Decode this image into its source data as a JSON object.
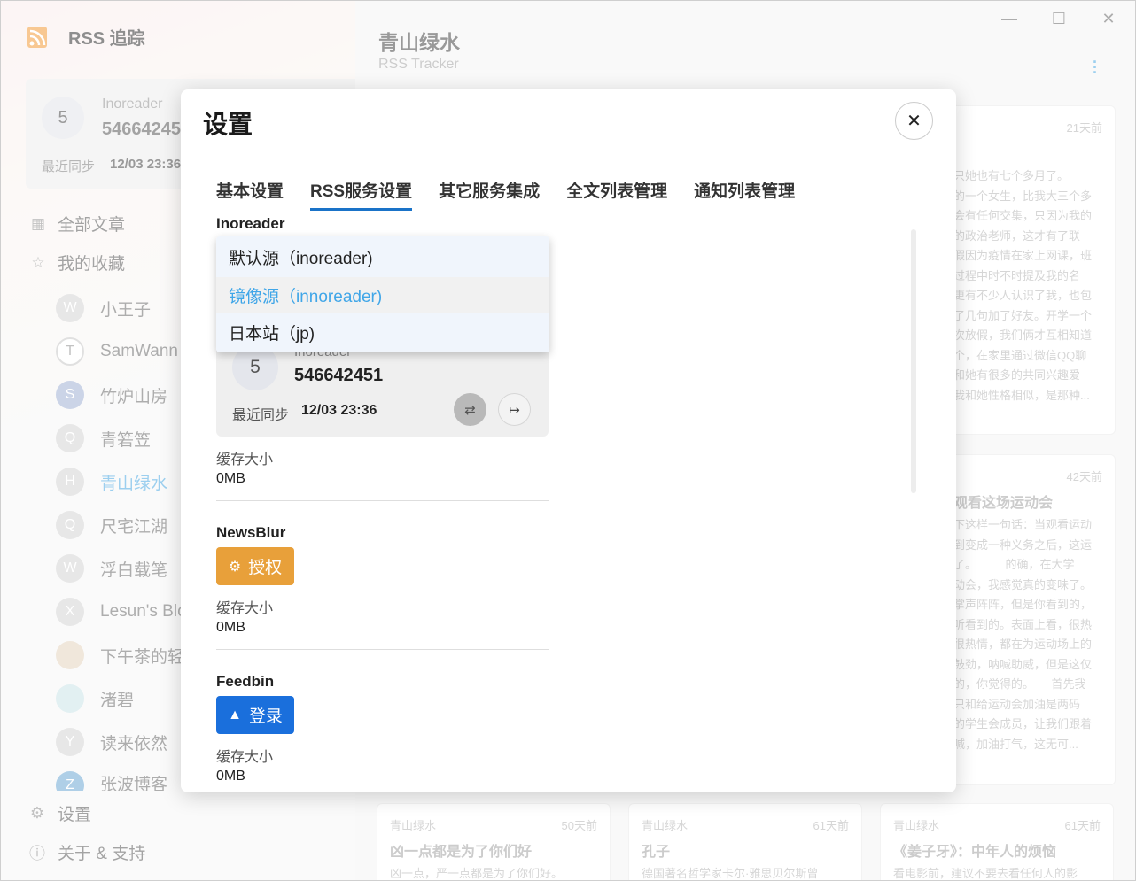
{
  "app": {
    "brand_name": "RSS 追踪",
    "account": {
      "avatar_letter": "5",
      "service": "Inoreader",
      "id": "546642451",
      "sync_label": "最近同步",
      "sync_time": "12/03 23:36"
    },
    "nav": {
      "all_articles": "全部文章",
      "favorites": "我的收藏"
    },
    "feeds": [
      {
        "letter": "W",
        "name": "小王子"
      },
      {
        "letter": "T",
        "name": "SamWann"
      },
      {
        "letter": "S",
        "name": "竹炉山房"
      },
      {
        "letter": "Q",
        "name": "青箬笠"
      },
      {
        "letter": "H",
        "name": "青山绿水"
      },
      {
        "letter": "Q",
        "name": "尺宅江湖"
      },
      {
        "letter": "W",
        "name": "浮白载笔"
      },
      {
        "letter": "X",
        "name": "Lesun's Blog"
      },
      {
        "letter": "",
        "name": "下午茶的轻"
      },
      {
        "letter": "",
        "name": "渚碧"
      },
      {
        "letter": "Y",
        "name": "读来依然"
      },
      {
        "letter": "Z",
        "name": "张波博客"
      }
    ],
    "bottom": {
      "settings": "设置",
      "about": "关于 & 支持"
    }
  },
  "main": {
    "title": "青山绿水",
    "subtitle": "RSS Tracker",
    "cards": [
      {
        "source": "",
        "ago": "21天前",
        "title": "",
        "excerpt": [
          "只她也有七个多月了。",
          "的一个女生，比我大三个多",
          "会有任何交集，只因为我的",
          "的政治老师，这才有了联",
          "假因为疫情在家上网课，班",
          "过程中时不时提及我的名",
          "更有不少人认识了我，也包",
          "了几句加了好友。开学一个",
          "次放假，我们俩才互相知道",
          "个，在家里通过微信QQ聊",
          "和她有很多的共同兴趣爱",
          "我和她性格相似，是那种..."
        ]
      },
      {
        "source": "",
        "ago": "42天前",
        "title": "观看这场运动会",
        "excerpt": [
          "下这样一句话：当观看运动",
          "到变成一种义务之后，这运",
          "了。　　　的确，在大学",
          "动会，我感觉真的变味了。",
          "掌声阵阵，但是你看到的，",
          "听看到的。表面上看，很热",
          "很热情，都在为运动场上的",
          "鼓劲，呐喊助威，但是这仅",
          "的，你觉得的。　　首先我",
          "只和给运动会加油是两码",
          "的学生会成员，让我们跟着",
          "喊，加油打气，这无可..."
        ]
      },
      {
        "source": "青山绿水",
        "ago": "50天前",
        "title": "凶一点都是为了你们好",
        "excerpt": [
          "凶一点，严一点都是为了你们好。"
        ]
      },
      {
        "source": "青山绿水",
        "ago": "61天前",
        "title": "孔子",
        "excerpt": [
          "德国著名哲学家卡尔·雅思贝尔斯曾"
        ]
      },
      {
        "source": "青山绿水",
        "ago": "61天前",
        "title": "《姜子牙》：中年人的烦恼",
        "excerpt": [
          "看电影前，建议不要去看任何人的影"
        ]
      }
    ]
  },
  "modal": {
    "title": "设置",
    "tabs": [
      "基本设置",
      "RSS服务设置",
      "其它服务集成",
      "全文列表管理",
      "通知列表管理"
    ],
    "active_tab": "RSS服务设置",
    "inoreader": {
      "section_title": "Inoreader",
      "dropdown_options": [
        "默认源（inoreader)",
        "镜像源（innoreader)",
        "日本站（jp)"
      ],
      "selected_option": "镜像源（innoreader)",
      "avatar_letter": "5",
      "service_name": "Inoreader",
      "user_id": "546642451",
      "sync_label": "最近同步",
      "sync_time": "12/03 23:36",
      "cache_label": "缓存大小",
      "cache_value": "0MB"
    },
    "newsblur": {
      "section_title": "NewsBlur",
      "button_label": "授权",
      "cache_label": "缓存大小",
      "cache_value": "0MB"
    },
    "feedbin": {
      "section_title": "Feedbin",
      "button_label": "登录",
      "cache_label": "缓存大小",
      "cache_value": "0MB"
    }
  },
  "colors": {
    "accent_blue": "#1a73c8",
    "link_blue": "#40a6e8",
    "newsblur_orange": "#e8a03a",
    "feedbin_blue": "#1a6fdc"
  },
  "icons": {
    "brand": "rss-icon",
    "close": "close-icon",
    "sync": "sync-icon",
    "logout": "logout-icon",
    "newsblur": "gear-icon",
    "feedbin": "hat-icon"
  }
}
